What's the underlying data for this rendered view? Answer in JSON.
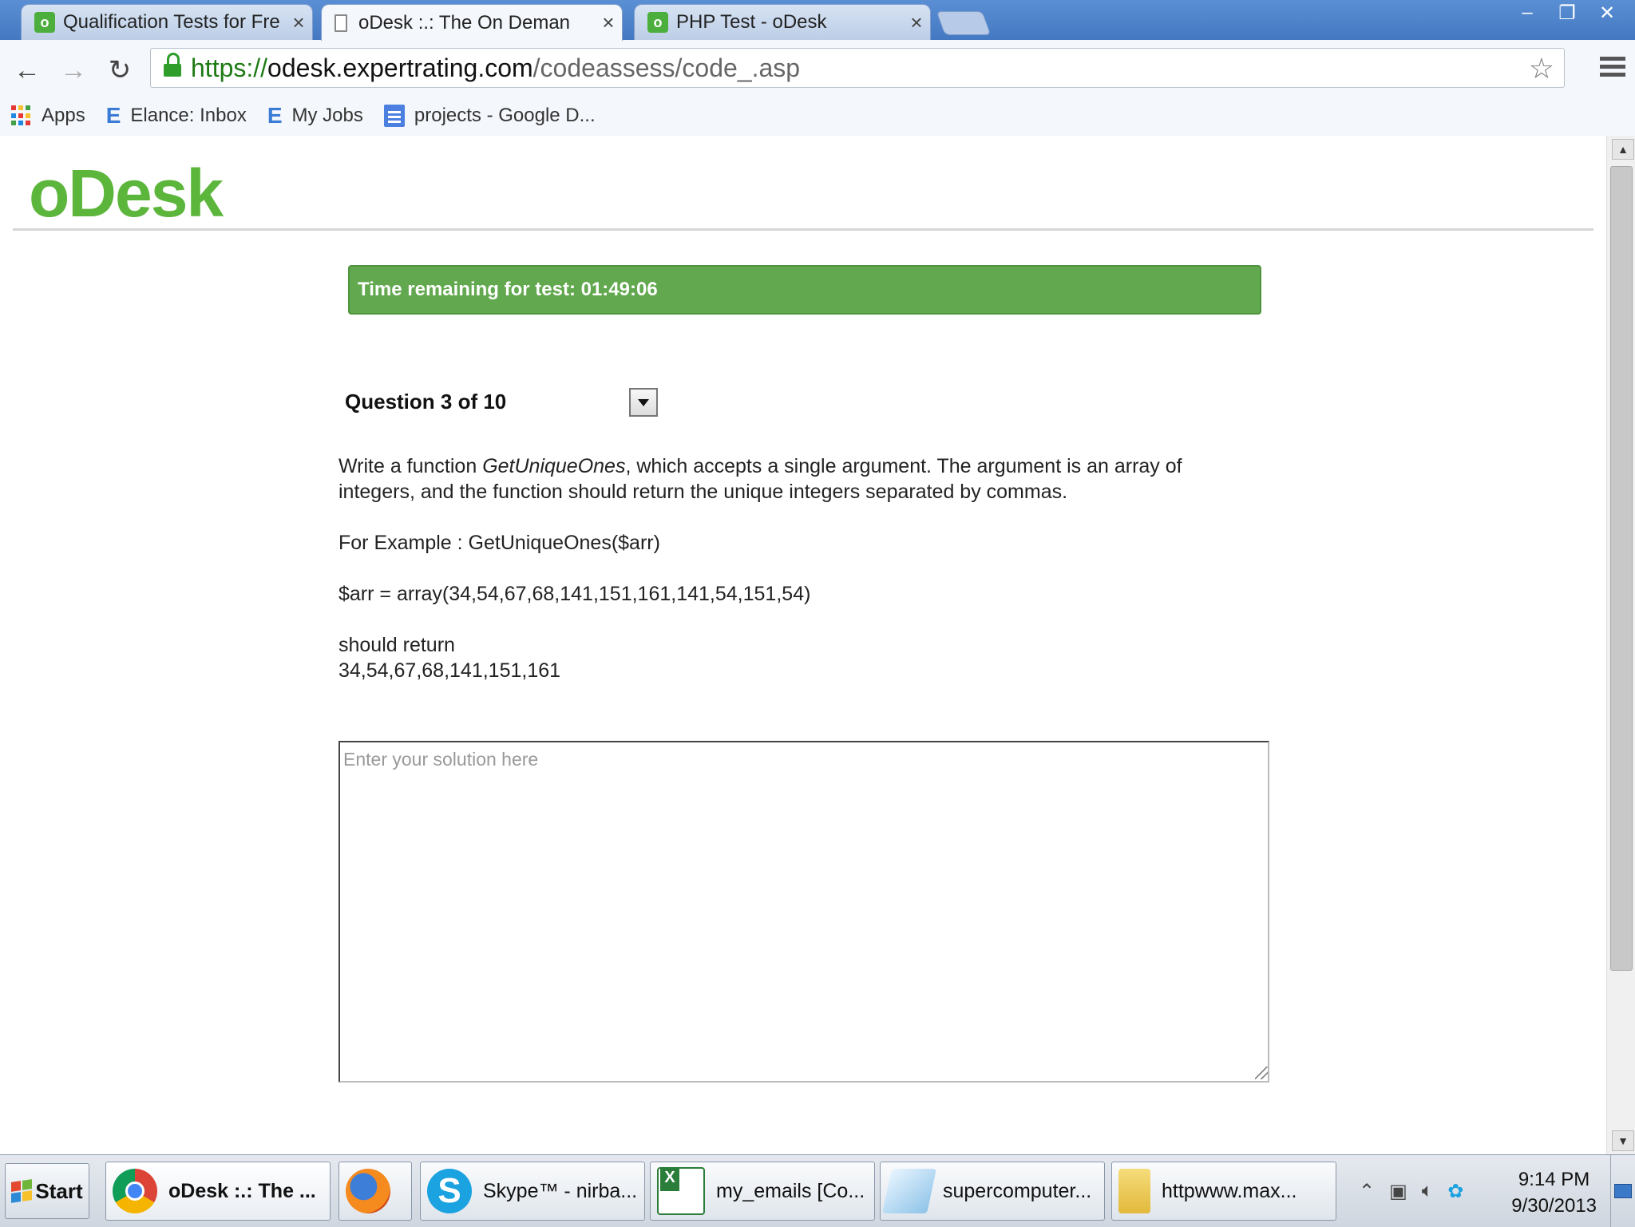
{
  "browser": {
    "tabs": [
      {
        "title": "Qualification Tests for Fre",
        "close": "×",
        "active": false,
        "favicon": "odesk-icon"
      },
      {
        "title": "oDesk :.: The On Deman",
        "close": "×",
        "active": true,
        "favicon": "page-icon"
      },
      {
        "title": "PHP Test - oDesk",
        "close": "×",
        "active": false,
        "favicon": "odesk-icon"
      }
    ],
    "window_controls": {
      "minimize": "–",
      "restore": "❐",
      "close": "✕"
    },
    "nav": {
      "back": "←",
      "forward": "→",
      "reload": "↻"
    },
    "url": {
      "scheme": "https://",
      "host": "odesk.expertrating.com",
      "path": "/codeassess/code_.asp"
    },
    "star": "☆",
    "bookmarks": [
      {
        "label": "Apps",
        "icon": "apps-grid-icon"
      },
      {
        "label": "Elance: Inbox",
        "icon": "elance-icon"
      },
      {
        "label": "My Jobs",
        "icon": "elance-icon"
      },
      {
        "label": "projects - Google D...",
        "icon": "google-docs-icon"
      }
    ]
  },
  "page": {
    "logo": "oDesk",
    "timer_text": "Time remaining for test: 01:49:06",
    "question_header": "Question 3 of 10",
    "question": {
      "intro_prefix": "Write a function ",
      "function_name": "GetUniqueOnes",
      "intro_suffix": ", which accepts a single argument. The argument is an array of integers, and the function should return the unique integers separated by commas.",
      "example_line": "For Example : GetUniqueOnes($arr)",
      "array_line": "$arr = array(34,54,67,68,141,151,161,141,54,151,54)",
      "should_return": "should return",
      "result": "34,54,67,68,141,151,161"
    },
    "answer": {
      "value": "",
      "placeholder": "Enter your solution here"
    }
  },
  "taskbar": {
    "start_label": "Start",
    "buttons": [
      {
        "label": "oDesk :.: The ...",
        "icon": "chrome-icon",
        "active": true
      },
      {
        "label": "",
        "icon": "firefox-icon",
        "active": false
      },
      {
        "label": "Skype™ - nirba...",
        "icon": "skype-icon",
        "active": false
      },
      {
        "label": "my_emails  [Co...",
        "icon": "excel-icon",
        "active": false
      },
      {
        "label": "supercomputer...",
        "icon": "notepad-icon",
        "active": false
      },
      {
        "label": "httpwww.max...",
        "icon": "folder-icon",
        "active": false
      }
    ],
    "clock": {
      "time": "9:14 PM",
      "date": "9/30/2013"
    }
  },
  "colors": {
    "brand_green": "#5cb63c",
    "timer_green": "#62a84e",
    "tabstrip_blue": "#4479c2"
  }
}
